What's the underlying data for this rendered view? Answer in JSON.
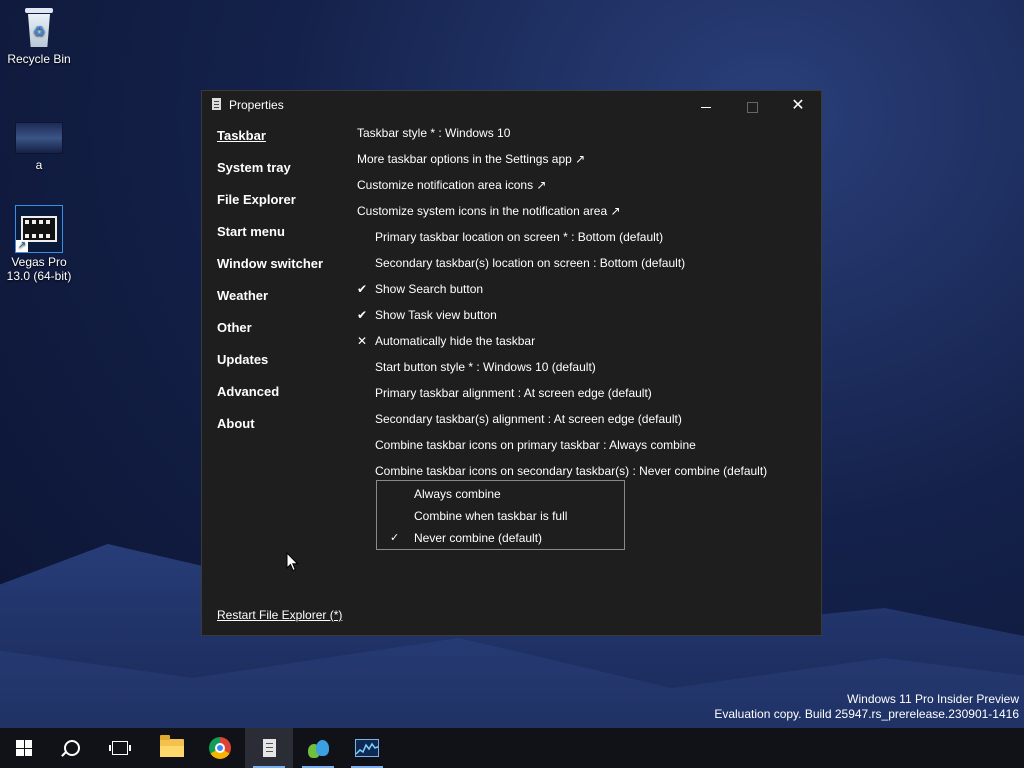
{
  "desktop": {
    "icons": [
      {
        "label": "Recycle Bin"
      },
      {
        "label": "a"
      },
      {
        "label": "Vegas Pro 13.0 (64-bit)"
      }
    ],
    "watermark": {
      "line1": "Windows 11 Pro Insider Preview",
      "line2": "Evaluation copy. Build 25947.rs_prerelease.230901-1416"
    }
  },
  "window": {
    "title": "Properties",
    "controls": {
      "minimize": "minimize-icon",
      "maximize": "maximize-icon",
      "close": "✕"
    },
    "nav": [
      {
        "label": "Taskbar",
        "active": true
      },
      {
        "label": "System tray"
      },
      {
        "label": "File Explorer"
      },
      {
        "label": "Start menu"
      },
      {
        "label": "Window switcher"
      },
      {
        "label": "Weather"
      },
      {
        "label": "Other"
      },
      {
        "label": "Updates"
      },
      {
        "label": "Advanced"
      },
      {
        "label": "About"
      }
    ],
    "settings": [
      {
        "label": "Taskbar style * : Windows 10",
        "mark": ""
      },
      {
        "label": "More taskbar options in the Settings app ↗",
        "mark": ""
      },
      {
        "label": "Customize notification area icons ↗",
        "mark": ""
      },
      {
        "label": "Customize system icons in the notification area ↗",
        "mark": ""
      },
      {
        "label": "Primary taskbar location on screen * : Bottom (default)",
        "mark": ""
      },
      {
        "label": "Secondary taskbar(s) location on screen : Bottom (default)",
        "mark": ""
      },
      {
        "label": "Show Search button",
        "mark": "✔"
      },
      {
        "label": "Show Task view button",
        "mark": "✔"
      },
      {
        "label": "Automatically hide the taskbar",
        "mark": "✕"
      },
      {
        "label": "Start button style * : Windows 10 (default)",
        "mark": ""
      },
      {
        "label": "Primary taskbar alignment : At screen edge (default)",
        "mark": ""
      },
      {
        "label": "Secondary taskbar(s) alignment : At screen edge (default)",
        "mark": ""
      },
      {
        "label": "Combine taskbar icons on primary taskbar : Always combine",
        "mark": ""
      },
      {
        "label": "Combine taskbar icons on secondary taskbar(s) : Never combine (default)",
        "mark": ""
      }
    ],
    "dropdown": {
      "options": [
        {
          "label": "Always combine",
          "check": ""
        },
        {
          "label": "Combine when taskbar is full",
          "check": ""
        },
        {
          "label": "Never combine (default)",
          "check": "✓"
        }
      ]
    },
    "restart_link": "Restart File Explorer (*)"
  },
  "taskbar": {
    "items": [
      {
        "icon": "start-icon"
      },
      {
        "icon": "search-icon"
      },
      {
        "icon": "task-view-icon"
      },
      {
        "icon": "file-explorer-icon"
      },
      {
        "icon": "chrome-icon"
      },
      {
        "icon": "properties-icon",
        "active": true
      },
      {
        "icon": "people-icon"
      },
      {
        "icon": "performance-monitor-icon"
      }
    ]
  },
  "colors": {
    "window_bg": "#1e1e1e",
    "taskbar_bg": "#101218",
    "active_indicator": "#7ab0f5"
  }
}
